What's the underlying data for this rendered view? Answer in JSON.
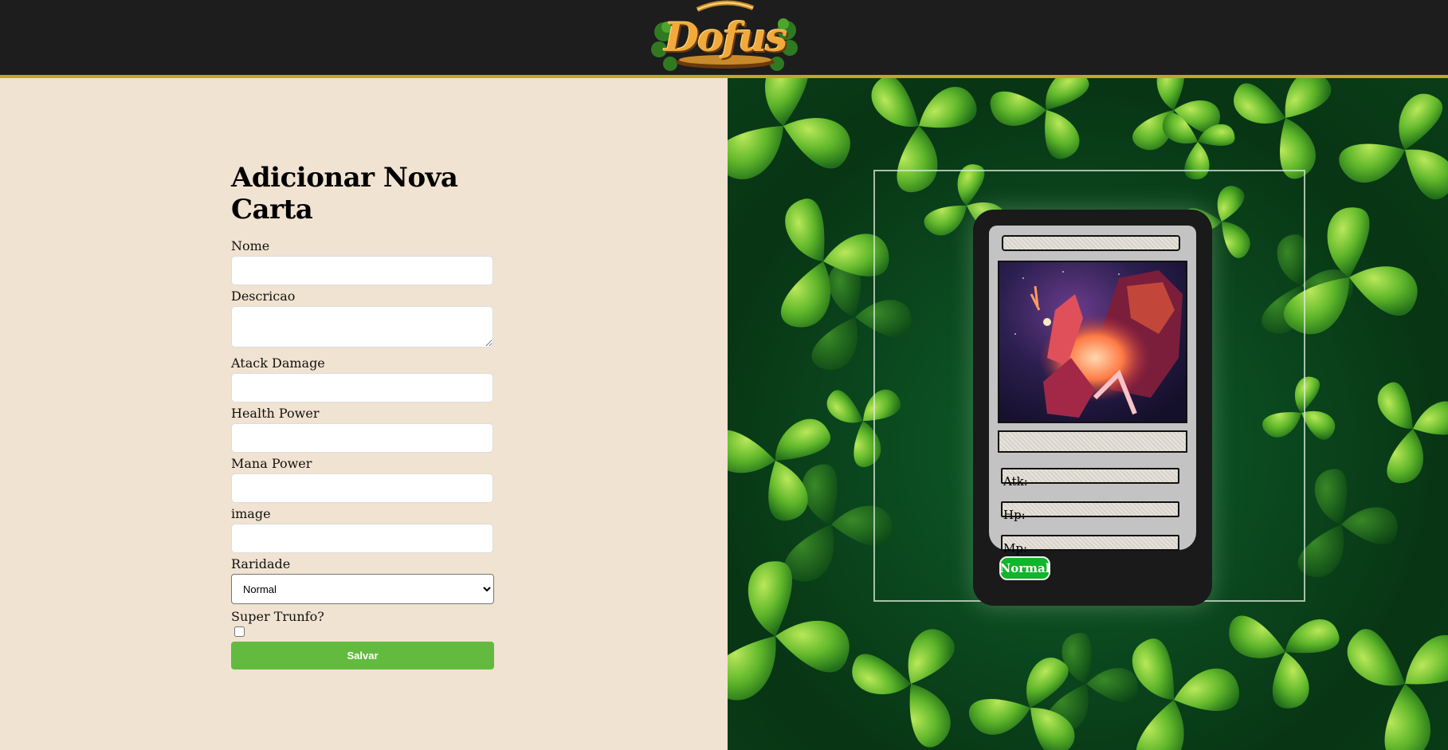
{
  "header": {
    "logo_text": "Dofus",
    "colors": {
      "background": "#1d1d1d",
      "accent_border": "#c9a22e"
    }
  },
  "form": {
    "title": "Adicionar Nova Carta",
    "fields": {
      "nome": {
        "label": "Nome",
        "value": ""
      },
      "descricao": {
        "label": "Descricao",
        "value": ""
      },
      "atack_damage": {
        "label": "Atack Damage",
        "value": ""
      },
      "health_power": {
        "label": "Health Power",
        "value": ""
      },
      "mana_power": {
        "label": "Mana Power",
        "value": ""
      },
      "image": {
        "label": "image",
        "value": ""
      },
      "raridade": {
        "label": "Raridade",
        "selected": "Normal"
      },
      "super_trunfo": {
        "label": "Super Trunfo?",
        "checked": false
      }
    },
    "save_label": "Salvar",
    "colors": {
      "save_button": "#62bb3f",
      "panel_background": "#f1e3d1"
    }
  },
  "preview": {
    "card": {
      "name": "",
      "description": "",
      "image_icon": "fiery-creature-artwork",
      "atk_label": "Atk:",
      "hp_label": "Hp:",
      "mp_label": "Mp:",
      "rarity": "Normal",
      "colors": {
        "rarity_badge": "#10b52c",
        "card_body": "#1a1a1a",
        "card_inner": "#c3c3c3"
      }
    },
    "background_icon": "clover-pattern"
  }
}
